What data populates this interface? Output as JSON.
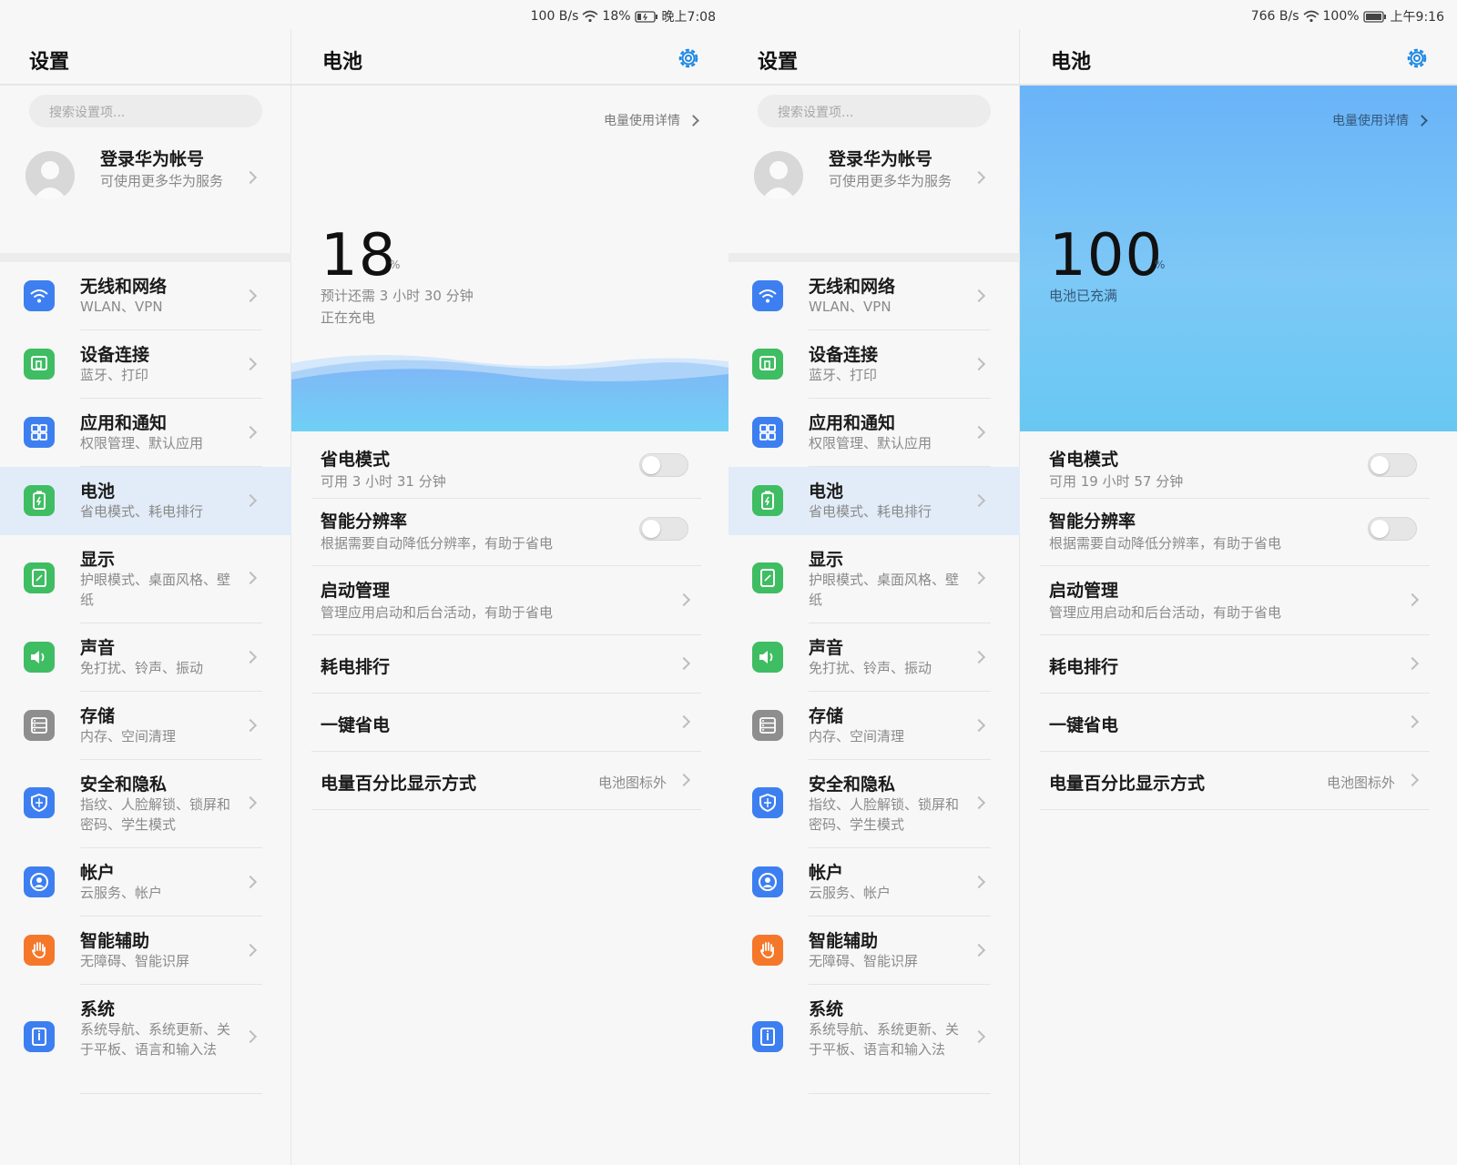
{
  "colors": {
    "accent": "#1e88e5",
    "battery_hero_top": "#69b3f8",
    "battery_hero_bottom": "#68c8f2",
    "active_bg": "#e2ecf8"
  },
  "screens": [
    {
      "status": {
        "net": "100 B/s",
        "wifi_pct": "18%",
        "time": "晚上7:08"
      },
      "settings": {
        "title": "设置",
        "search_placeholder": "搜索设置项...",
        "account": {
          "name": "登录华为帐号",
          "sub": "可使用更多华为服务"
        },
        "items": [
          {
            "label": "无线和网络",
            "sub": "WLAN、VPN",
            "icon": "wifi-icon"
          },
          {
            "label": "设备连接",
            "sub": "蓝牙、打印",
            "icon": "device-connect-icon"
          },
          {
            "label": "应用和通知",
            "sub": "权限管理、默认应用",
            "icon": "apps-icon"
          },
          {
            "label": "电池",
            "sub": "省电模式、耗电排行",
            "icon": "battery-icon"
          },
          {
            "label": "显示",
            "sub": "护眼模式、桌面风格、壁纸",
            "icon": "display-icon"
          },
          {
            "label": "声音",
            "sub": "免打扰、铃声、振动",
            "icon": "sound-icon"
          },
          {
            "label": "存储",
            "sub": "内存、空间清理",
            "icon": "storage-icon"
          },
          {
            "label": "安全和隐私",
            "sub": "指纹、人脸解锁、锁屏和密码、学生模式",
            "icon": "shield-icon"
          },
          {
            "label": "帐户",
            "sub": "云服务、帐户",
            "icon": "account-icon"
          },
          {
            "label": "智能辅助",
            "sub": "无障碍、智能识屏",
            "icon": "hand-icon"
          },
          {
            "label": "系统",
            "sub": "系统导航、系统更新、关于平板、语言和输入法",
            "icon": "system-icon"
          }
        ]
      },
      "battery": {
        "title": "电池",
        "detail_link": "电量使用详情",
        "percent": "18",
        "percent_unit": "%",
        "line1": "预计还需 3 小时 30 分钟",
        "line2": "正在充电",
        "rows": {
          "power_saving": {
            "title": "省电模式",
            "sub": "可用 3 小时 31 分钟",
            "on": false
          },
          "smart_resolution": {
            "title": "智能分辨率",
            "sub": "根据需要自动降低分辨率，有助于省电",
            "on": false
          },
          "startup": {
            "title": "启动管理",
            "sub": "管理应用启动和后台活动，有助于省电"
          },
          "ranking": {
            "title": "耗电排行"
          },
          "one_key": {
            "title": "一键省电"
          },
          "percent_display": {
            "title": "电量百分比显示方式",
            "value": "电池图标外"
          }
        }
      }
    },
    {
      "status": {
        "net": "766 B/s",
        "wifi_pct": "100%",
        "time": "上午9:16"
      },
      "settings": {
        "title": "设置",
        "search_placeholder": "搜索设置项...",
        "account": {
          "name": "登录华为帐号",
          "sub": "可使用更多华为服务"
        },
        "items": [
          {
            "label": "无线和网络",
            "sub": "WLAN、VPN",
            "icon": "wifi-icon"
          },
          {
            "label": "设备连接",
            "sub": "蓝牙、打印",
            "icon": "device-connect-icon"
          },
          {
            "label": "应用和通知",
            "sub": "权限管理、默认应用",
            "icon": "apps-icon"
          },
          {
            "label": "电池",
            "sub": "省电模式、耗电排行",
            "icon": "battery-icon"
          },
          {
            "label": "显示",
            "sub": "护眼模式、桌面风格、壁纸",
            "icon": "display-icon"
          },
          {
            "label": "声音",
            "sub": "免打扰、铃声、振动",
            "icon": "sound-icon"
          },
          {
            "label": "存储",
            "sub": "内存、空间清理",
            "icon": "storage-icon"
          },
          {
            "label": "安全和隐私",
            "sub": "指纹、人脸解锁、锁屏和密码、学生模式",
            "icon": "shield-icon"
          },
          {
            "label": "帐户",
            "sub": "云服务、帐户",
            "icon": "account-icon"
          },
          {
            "label": "智能辅助",
            "sub": "无障碍、智能识屏",
            "icon": "hand-icon"
          },
          {
            "label": "系统",
            "sub": "系统导航、系统更新、关于平板、语言和输入法",
            "icon": "system-icon"
          }
        ]
      },
      "battery": {
        "title": "电池",
        "detail_link": "电量使用详情",
        "percent": "100",
        "percent_unit": "%",
        "line1": "电池已充满",
        "rows": {
          "power_saving": {
            "title": "省电模式",
            "sub": "可用 19 小时 57 分钟",
            "on": false
          },
          "smart_resolution": {
            "title": "智能分辨率",
            "sub": "根据需要自动降低分辨率，有助于省电",
            "on": false
          },
          "startup": {
            "title": "启动管理",
            "sub": "管理应用启动和后台活动，有助于省电"
          },
          "ranking": {
            "title": "耗电排行"
          },
          "one_key": {
            "title": "一键省电"
          },
          "percent_display": {
            "title": "电量百分比显示方式",
            "value": "电池图标外"
          }
        }
      }
    }
  ]
}
